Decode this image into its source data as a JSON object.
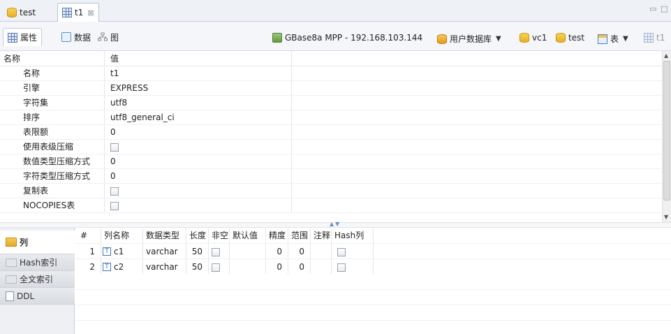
{
  "editor_tabs": [
    {
      "label": "test"
    },
    {
      "label": "t1",
      "close": "⊠"
    }
  ],
  "sub_tabs": [
    {
      "label": "属性"
    },
    {
      "label": "数据"
    },
    {
      "label": "图"
    }
  ],
  "connection": {
    "server": "GBase8a MPP - 192.168.103.144",
    "user_db": "用户数据库",
    "vc": "vc1",
    "database": "test",
    "object_type": "表",
    "table": "t1"
  },
  "properties": {
    "header_name": "名称",
    "header_value": "值",
    "rows": [
      {
        "name": "名称",
        "value": "t1",
        "checkbox": false
      },
      {
        "name": "引擎",
        "value": "EXPRESS",
        "checkbox": false
      },
      {
        "name": "字符集",
        "value": "utf8",
        "checkbox": false
      },
      {
        "name": "排序",
        "value": "utf8_general_ci",
        "checkbox": false
      },
      {
        "name": "表限额",
        "value": "0",
        "checkbox": false
      },
      {
        "name": "使用表级压缩",
        "value": "",
        "checkbox": true
      },
      {
        "name": "数值类型压缩方式",
        "value": "0",
        "checkbox": false
      },
      {
        "name": "字符类型压缩方式",
        "value": "0",
        "checkbox": false
      },
      {
        "name": "复制表",
        "value": "",
        "checkbox": true
      },
      {
        "name": "NOCOPIES表",
        "value": "",
        "checkbox": true
      }
    ]
  },
  "left_nav": [
    {
      "label": "列",
      "active": true
    },
    {
      "label": "Hash索引",
      "active": false
    },
    {
      "label": "全文索引",
      "active": false
    },
    {
      "label": "DDL",
      "active": false
    }
  ],
  "columns_table": {
    "headers": [
      "#",
      "列名称",
      "数据类型",
      "长度",
      "非空",
      "默认值",
      "精度",
      "范围",
      "注释",
      "Hash列"
    ],
    "rows": [
      {
        "index": "1",
        "icon": "T",
        "name": "c1",
        "type": "varchar",
        "length": "50",
        "precision": "0",
        "scale": "0"
      },
      {
        "index": "2",
        "icon": "T",
        "name": "c2",
        "type": "varchar",
        "length": "50",
        "precision": "0",
        "scale": "0"
      }
    ]
  }
}
